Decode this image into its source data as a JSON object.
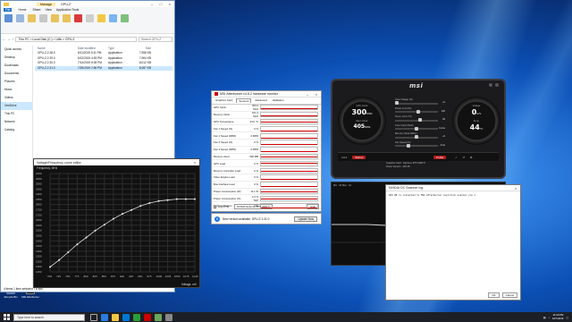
{
  "explorer": {
    "title": "GPU-Z",
    "manage_tab": "Manage",
    "ribbon_tabs": [
      "File",
      "Home",
      "Share",
      "View",
      "Application Tools"
    ],
    "address": "This PC > Local Disk (C:) > Utils > GPU-Z",
    "search_placeholder": "Search GPU-Z",
    "nav_items": [
      "Quick access",
      "Desktop",
      "Downloads",
      "Documents",
      "Pictures",
      "Music",
      "Videos",
      "OneDrive",
      "This PC",
      "Network",
      "Catalog"
    ],
    "columns": [
      "Name",
      "Date modified",
      "Type",
      "Size"
    ],
    "files": [
      {
        "name": "GPU-Z.2.28.0",
        "date": "6/11/2019 5:11 PM",
        "type": "Application",
        "size": "7,958 KB"
      },
      {
        "name": "GPU-Z.2.29.0",
        "date": "6/12/2019 4:53 PM",
        "type": "Application",
        "size": "7,964 KB"
      },
      {
        "name": "GPU-Z.2.30.0",
        "date": "7/14/2019 8:35 PM",
        "type": "Application",
        "size": "8,012 KB"
      },
      {
        "name": "GPU-Z.2.31.0",
        "date": "7/25/2019 2:56 PM",
        "type": "Application",
        "size": "8,087 KB"
      }
    ],
    "status": "4 items  1 item selected  7.8 MB"
  },
  "curve_editor": {
    "title": "Voltage/Frequency curve editor",
    "header": "Frequency, MHz",
    "footer": "Voltage, mV",
    "y_ticks": [
      "2100",
      "2050",
      "2000",
      "1950",
      "1900",
      "1850",
      "1800",
      "1750",
      "1700",
      "1650",
      "1600",
      "1550",
      "1500",
      "1450",
      "1400",
      "1350",
      "1300",
      "1250",
      "1200",
      "1150"
    ],
    "x_ticks": [
      "700",
      "725",
      "750",
      "775",
      "800",
      "825",
      "850",
      "875",
      "900",
      "925",
      "950",
      "975",
      "1000",
      "1025",
      "1050",
      "1075",
      "1100"
    ],
    "curve": [
      0.05,
      0.12,
      0.2,
      0.28,
      0.35,
      0.42,
      0.48,
      0.54,
      0.59,
      0.63,
      0.67,
      0.7,
      0.72,
      0.73,
      0.74,
      0.74,
      0.74
    ]
  },
  "monitor": {
    "title": "MSI Afterburner v4.6.2 hardware monitor",
    "tabs": [
      "Graphics Card",
      "Sensors",
      "Advanced",
      "Validation"
    ],
    "rows": [
      {
        "label": "GPU Clock",
        "value": "300.0 MHz",
        "line": 0.7
      },
      {
        "label": "Memory Clock",
        "value": "101.3 MHz",
        "line": 0.8
      },
      {
        "label": "GPU Temperature",
        "value": "44.0 °C",
        "line": 0.5
      },
      {
        "label": "Fan 1 Speed (%)",
        "value": "0 %",
        "line": 1
      },
      {
        "label": "Fan 1 Speed (RPM)",
        "value": "0 RPM",
        "line": 1
      },
      {
        "label": "Fan 2 Speed (%)",
        "value": "0 %",
        "line": 1
      },
      {
        "label": "Fan 2 Speed (RPM)",
        "value": "0 RPM",
        "line": 1
      },
      {
        "label": "Memory Used",
        "value": "590 MB",
        "line": 0.6
      },
      {
        "label": "GPU Load",
        "value": "0 %",
        "line": 0.3
      },
      {
        "label": "Memory Controller Load",
        "value": "0 %",
        "line": 0.5
      },
      {
        "label": "Video Engine Load",
        "value": "0 %",
        "line": 1
      },
      {
        "label": "Bus Interface Load",
        "value": "0 %",
        "line": 1
      },
      {
        "label": "Power Consumption (W)",
        "value": "11.1 W",
        "line": 0.4
      },
      {
        "label": "Power Consumption (%)",
        "value": "4.3 % TDP",
        "line": 0.45
      },
      {
        "label": "PerfCap Reason",
        "value": "Idle",
        "line": 1
      }
    ],
    "log_label": "Log to file",
    "gpu_select": "NVIDIA GeForce RTX 2080 Ti",
    "hide_label": "Hide"
  },
  "update": {
    "text": "New version available: GPU-Z 2.31.0",
    "button": "Update Now"
  },
  "afterburner": {
    "logo": "msi",
    "gpu_clock_value": "300",
    "gpu_clock_unit": "MHz",
    "gpu_clock_label": "GPU Clock",
    "mem_clock_value": "405",
    "mem_clock_unit": "MHz",
    "mem_clock_label": "Mem Clock",
    "voltage_value": "0",
    "voltage_unit": "mV",
    "voltage_label": "Voltage",
    "temp_value": "44",
    "temp_unit": "°C",
    "temp_label": "Temp.",
    "sliders": [
      {
        "label": "Core Voltage (%)",
        "value": "+0",
        "pos": 0.0
      },
      {
        "label": "Power Limit (%)",
        "value": "100",
        "pos": 0.55
      },
      {
        "label": "Temp. Limit (°C)",
        "value": "84",
        "pos": 0.6
      },
      {
        "label": "Core Clock (MHz)",
        "value": "Curve",
        "pos": 0.5
      },
      {
        "label": "Memory Clock (MHz)",
        "value": "+0",
        "pos": 0.5
      },
      {
        "label": "Fan Speed (%)",
        "value": "Auto",
        "pos": 0.3
      }
    ],
    "version": "4.6.2",
    "startup": "Startup",
    "profile": "Profile",
    "gpu_line": "Graphics Card : GeForce RTX 2080 Ti",
    "driver_line": "Driver Version : 436.48",
    "graph_left": "Min : 33  Max : 44",
    "graph_right": "GPU temperature, °C"
  },
  "log": {
    "title": "NVIDIA OC Scanner log",
    "text": "GPU #0 is connected to MSI Afterburner overclock scanner via 1",
    "ok": "OK",
    "cancel": "Cancel"
  },
  "desktop_icons": [
    {
      "label": "Recycle Bin"
    },
    {
      "label": "MSI Afterburner"
    }
  ],
  "taskbar": {
    "search": "Type here to search",
    "time": "11:00 PM",
    "date": "10/7/2019"
  },
  "colors": {
    "accent_red": "#c00000",
    "taskbar": "#1c1f26",
    "selection": "#cce8ff"
  }
}
